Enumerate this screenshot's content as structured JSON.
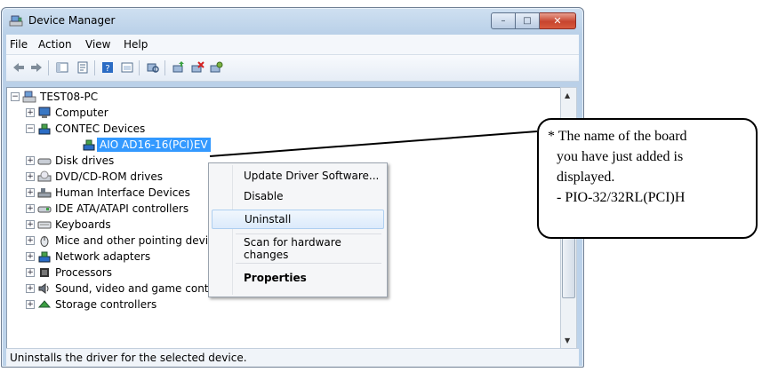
{
  "window": {
    "title": "Device Manager",
    "minimize": "–",
    "maximize": "□",
    "close": "✕"
  },
  "menu": [
    "File",
    "Action",
    "View",
    "Help"
  ],
  "toolbar": {
    "icons": [
      "back-icon",
      "forward-icon",
      "show-hide-tree-icon",
      "properties-icon",
      "help-icon",
      "view-icon",
      "scan-hardware-icon",
      "update-driver-icon",
      "uninstall-icon",
      "disable-icon"
    ]
  },
  "tree": {
    "root": "TEST08-PC",
    "items": [
      {
        "label": "Computer"
      },
      {
        "label": "CONTEC Devices"
      },
      {
        "label": "AIO AD16-16(PCI)EV"
      },
      {
        "label": "Disk drives"
      },
      {
        "label": "DVD/CD-ROM drives"
      },
      {
        "label": "Human Interface Devices"
      },
      {
        "label": "IDE ATA/ATAPI controllers"
      },
      {
        "label": "Keyboards"
      },
      {
        "label": "Mice and other pointing devices"
      },
      {
        "label": "Network adapters"
      },
      {
        "label": "Processors"
      },
      {
        "label": "Sound, video and game controllers"
      },
      {
        "label": "Storage controllers"
      }
    ],
    "expand_collapsed": "+",
    "expand_open": "−"
  },
  "context_menu": {
    "items": [
      "Update Driver Software...",
      "Disable",
      "Uninstall",
      "Scan for hardware changes",
      "Properties"
    ],
    "highlighted": "Uninstall"
  },
  "statusbar": {
    "text": "Uninstalls the driver for the selected device."
  },
  "callout": {
    "lines": [
      "* The name of the board",
      "you have just added is",
      "displayed.",
      "- PIO-32/32RL(PCI)H"
    ]
  },
  "colors": {
    "selection": "#3399ff",
    "accent": "#2b6cc4"
  }
}
